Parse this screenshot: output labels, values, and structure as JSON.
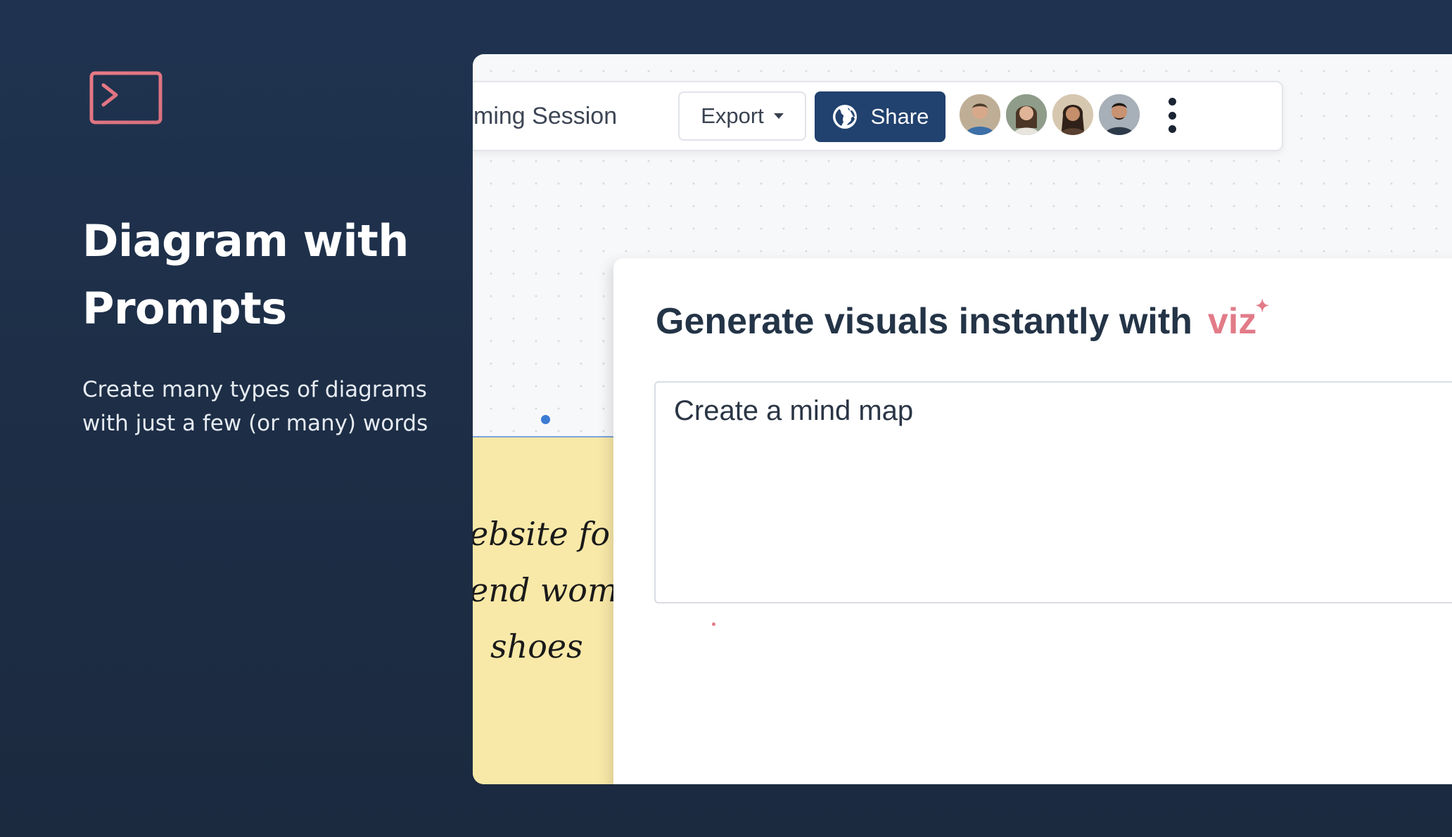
{
  "hero": {
    "title": "Diagram with Prompts",
    "description": "Create many types of diagrams with just a few (or many) words",
    "icon": "terminal-icon",
    "accent_color": "#e27b88"
  },
  "toolbar": {
    "session_title": "ming Session",
    "export_label": "Export",
    "share_label": "Share",
    "share_color": "#21416e",
    "avatars": [
      "user-avatar-1",
      "user-avatar-2",
      "user-avatar-3",
      "user-avatar-4"
    ]
  },
  "canvas": {
    "sticky_note": {
      "lines": [
        "ebsite fo",
        "end wom",
        "shoes"
      ],
      "color": "#f9e9a8"
    }
  },
  "prompt_panel": {
    "heading": "Generate visuals instantly with",
    "brand": "viz",
    "input_value": "Create a mind map"
  }
}
